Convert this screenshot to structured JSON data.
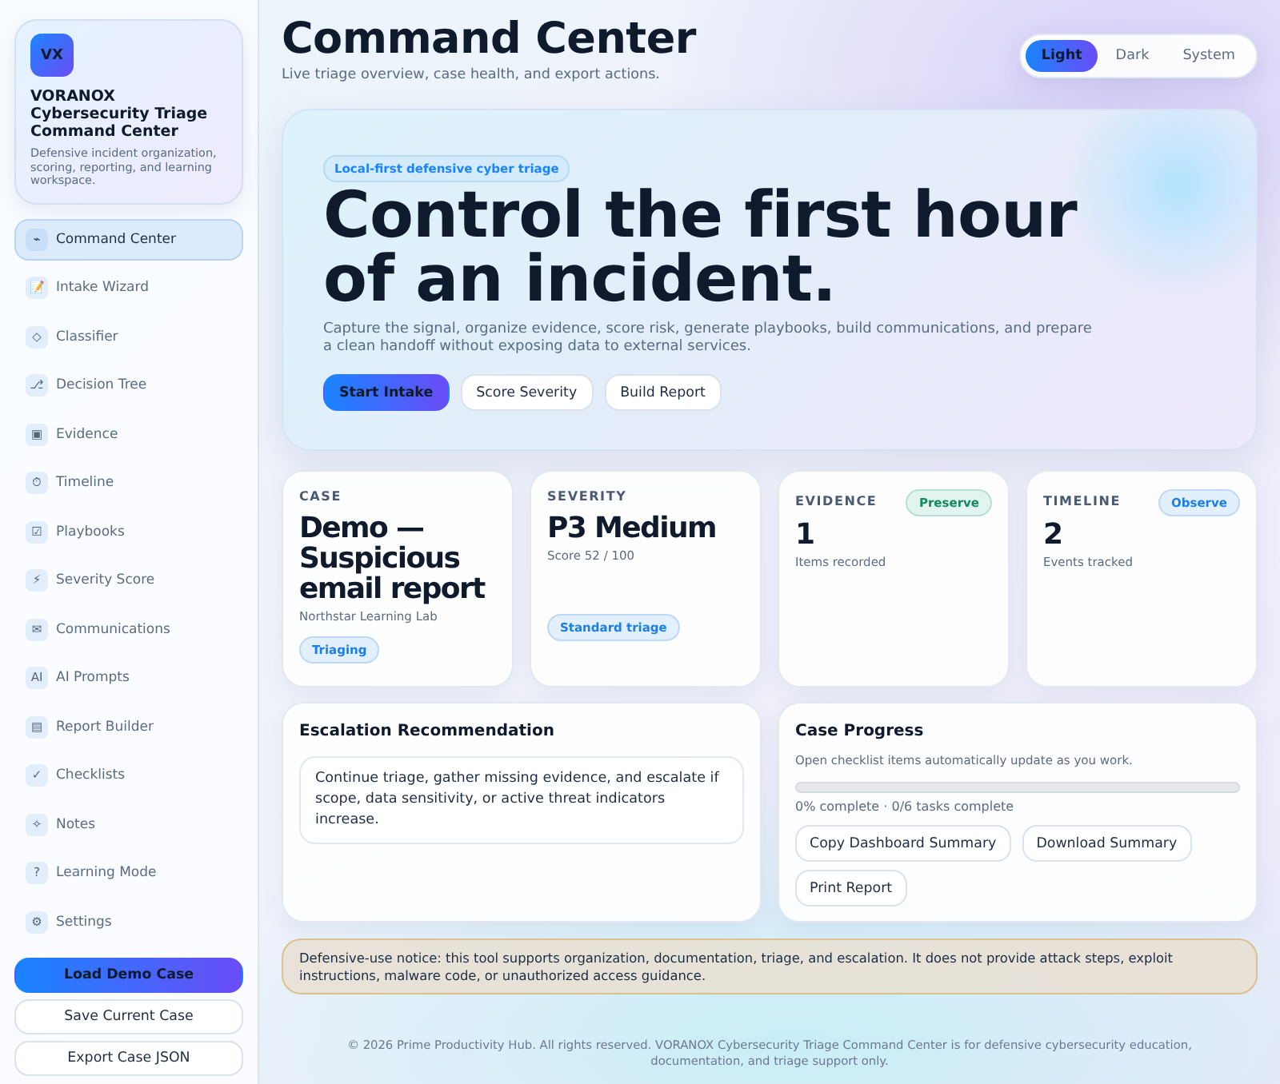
{
  "sidebar": {
    "brand": {
      "logo": "VX",
      "title": "VORANOX Cybersecurity Triage Command Center",
      "description": "Defensive incident organization, scoring, reporting, and learning workspace."
    },
    "nav": [
      {
        "icon": "⌁",
        "label": "Command Center",
        "selected": true
      },
      {
        "icon": "📝",
        "label": "Intake Wizard",
        "selected": false
      },
      {
        "icon": "◇",
        "label": "Classifier",
        "selected": false
      },
      {
        "icon": "⎇",
        "label": "Decision Tree",
        "selected": false
      },
      {
        "icon": "▣",
        "label": "Evidence",
        "selected": false
      },
      {
        "icon": "⏱",
        "label": "Timeline",
        "selected": false
      },
      {
        "icon": "☑",
        "label": "Playbooks",
        "selected": false
      },
      {
        "icon": "⚡",
        "label": "Severity Score",
        "selected": false
      },
      {
        "icon": "✉",
        "label": "Communications",
        "selected": false
      },
      {
        "icon": "AI",
        "label": "AI Prompts",
        "selected": false
      },
      {
        "icon": "▤",
        "label": "Report Builder",
        "selected": false
      },
      {
        "icon": "✓",
        "label": "Checklists",
        "selected": false
      },
      {
        "icon": "✧",
        "label": "Notes",
        "selected": false
      },
      {
        "icon": "?",
        "label": "Learning Mode",
        "selected": false
      },
      {
        "icon": "⚙",
        "label": "Settings",
        "selected": false
      }
    ],
    "actions": [
      {
        "label": "Load Demo Case",
        "kind": "primary"
      },
      {
        "label": "Save Current Case",
        "kind": "secondary"
      },
      {
        "label": "Export Case JSON",
        "kind": "secondary"
      }
    ]
  },
  "header": {
    "title": "Command Center",
    "subtitle": "Live triage overview, case health, and export actions.",
    "theme_options": [
      {
        "label": "Light",
        "selected": true
      },
      {
        "label": "Dark",
        "selected": false
      },
      {
        "label": "System",
        "selected": false
      }
    ]
  },
  "hero": {
    "badge": "Local-first defensive cyber triage",
    "headline": "Control the first hour of an incident.",
    "text": "Capture the signal, organize evidence, score risk, generate playbooks, build communications, and prepare a clean handoff without exposing data to external services.",
    "buttons": [
      {
        "label": "Start Intake",
        "kind": "primary"
      },
      {
        "label": "Score Severity",
        "kind": "secondary"
      },
      {
        "label": "Build Report",
        "kind": "secondary"
      }
    ]
  },
  "stats": [
    {
      "kind": "summary",
      "label": "CASE",
      "value": "Demo — Suspicious email report",
      "detail": "Northstar Learning Lab",
      "badge": {
        "label": "Triaging",
        "kind": "info"
      }
    },
    {
      "kind": "summary",
      "label": "SEVERITY",
      "value": "P3 Medium",
      "detail": "Score 52 / 100",
      "badge": {
        "label": "Standard triage",
        "kind": "info"
      }
    },
    {
      "kind": "metric",
      "label": "EVIDENCE",
      "value": "1",
      "detail": "Items recorded",
      "badge": {
        "label": "Preserve",
        "kind": "success"
      }
    },
    {
      "kind": "metric",
      "label": "TIMELINE",
      "value": "2",
      "detail": "Events tracked",
      "badge": {
        "label": "Observe",
        "kind": "info"
      }
    }
  ],
  "escalation": {
    "title": "Escalation Recommendation",
    "text": "Continue triage, gather missing evidence, and escalate if scope, data sensitivity, or active threat indicators increase."
  },
  "progress": {
    "title": "Case Progress",
    "description": "Open checklist items automatically update as you work.",
    "level": 0,
    "status": "0% complete · 0/6 tasks complete",
    "buttons": [
      "Copy Dashboard Summary",
      "Download Summary",
      "Print Report"
    ]
  },
  "notice": "Defensive-use notice: this tool supports organization, documentation, triage, and escalation. It does not provide attack steps, exploit instructions, malware code, or unauthorized access guidance.",
  "footer": "© 2026 Prime Productivity Hub. All rights reserved. VORANOX Cybersecurity Triage Command Center is for defensive cybersecurity education, documentation, and triage support only."
}
